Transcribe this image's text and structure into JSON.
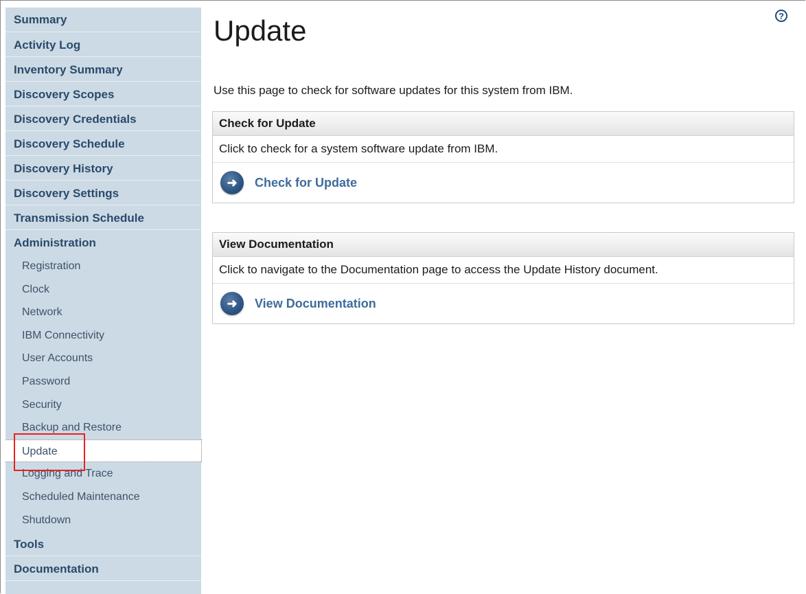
{
  "sidebar": {
    "items": [
      {
        "label": "Summary"
      },
      {
        "label": "Activity Log"
      },
      {
        "label": "Inventory Summary"
      },
      {
        "label": "Discovery Scopes"
      },
      {
        "label": "Discovery Credentials"
      },
      {
        "label": "Discovery Schedule"
      },
      {
        "label": "Discovery History"
      },
      {
        "label": "Discovery Settings"
      },
      {
        "label": "Transmission Schedule"
      },
      {
        "label": "Administration"
      }
    ],
    "admin_items": [
      {
        "label": "Registration"
      },
      {
        "label": "Clock"
      },
      {
        "label": "Network"
      },
      {
        "label": "IBM Connectivity"
      },
      {
        "label": "User Accounts"
      },
      {
        "label": "Password"
      },
      {
        "label": "Security"
      },
      {
        "label": "Backup and Restore"
      },
      {
        "label": "Update"
      },
      {
        "label": "Logging and Trace"
      },
      {
        "label": "Scheduled Maintenance"
      },
      {
        "label": "Shutdown"
      }
    ],
    "bottom_items": [
      {
        "label": "Tools"
      },
      {
        "label": "Documentation"
      }
    ],
    "selected": "Update"
  },
  "main": {
    "help_icon": "?",
    "title": "Update",
    "intro": "Use this page to check for software updates for this system from IBM.",
    "panels": [
      {
        "header": "Check for Update",
        "description": "Click to check for a system software update from IBM.",
        "action_label": "Check for Update",
        "action_icon": "arrow-right-circle-icon"
      },
      {
        "header": "View Documentation",
        "description": "Click to navigate to the Documentation page to access the Update History document.",
        "action_label": "View Documentation",
        "action_icon": "arrow-right-circle-icon"
      }
    ]
  },
  "colors": {
    "sidebar_bg": "#ccdae5",
    "nav_text": "#2a4a6a",
    "link_text": "#3f6b9c",
    "highlight_border": "#e8211e"
  }
}
